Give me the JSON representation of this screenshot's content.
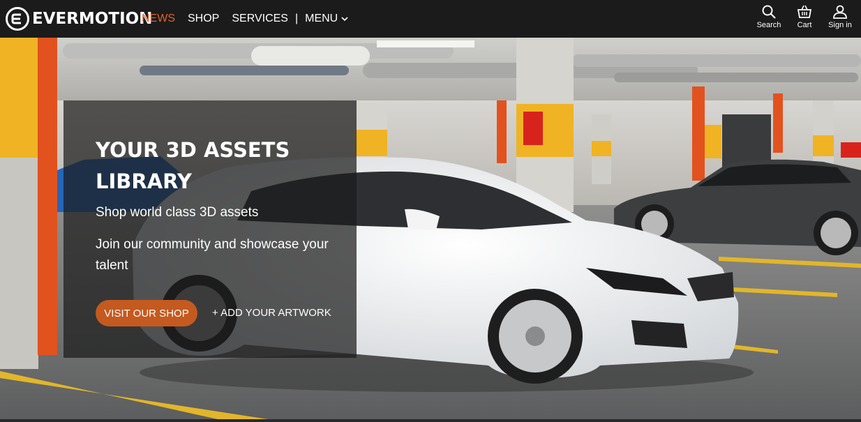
{
  "header": {
    "logo_text": "EVERMOTION",
    "nav": {
      "news": "NEWS",
      "shop": "SHOP",
      "services": "SERVICES",
      "separator": "|",
      "menu": "MENU"
    },
    "tools": {
      "search": "Search",
      "cart": "Cart",
      "signin": "Sign in"
    }
  },
  "hero": {
    "headline": "YOUR 3D ASSETS LIBRARY",
    "line1": "Shop world class 3D assets",
    "line2": "Join our community and showcase your talent",
    "primary_button": "VISIT OUR SHOP",
    "secondary_link": "+ ADD YOUR ARTWORK"
  },
  "colors": {
    "accent": "#e4622a",
    "button": "#c45a1f",
    "topbar": "#1b1b1b"
  },
  "icons": [
    "logo-e-icon",
    "chevron-down-icon",
    "search-icon",
    "cart-icon",
    "user-icon"
  ]
}
